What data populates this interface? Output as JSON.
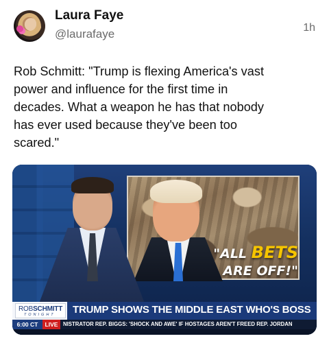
{
  "post": {
    "author_name": "Laura Faye",
    "author_handle": "@laurafaye",
    "timestamp": "1h",
    "text": "Rob Schmitt: \"Trump is flexing America's vast\npower and influence for the first time in\ndecades. What a weapon he has that nobody\nhas ever used because they've been too\nscared.\""
  },
  "media": {
    "screen_quote_line1_prefix": "\"ALL ",
    "screen_quote_line1_emphasis": "BETS",
    "screen_quote_line2": "ARE OFF!\"",
    "show_logo_line1_a": "ROB",
    "show_logo_line1_b": "SCHMITT",
    "show_logo_line2": "TONIGHT",
    "chyron_headline": "TRUMP SHOWS THE MIDDLE EAST WHO'S BOSS",
    "ticker_time": "6:00 CT",
    "ticker_live": "LIVE",
    "ticker_text": "NISTRATOR    REP. BIGGS: 'SHOCK AND AWE' IF HOSTAGES AREN'T FREED    REP. JORDAN",
    "colors": {
      "chyron_blue": "#1b3a7a",
      "live_red": "#cf1f1f",
      "quote_yellow": "#f5c400"
    }
  }
}
